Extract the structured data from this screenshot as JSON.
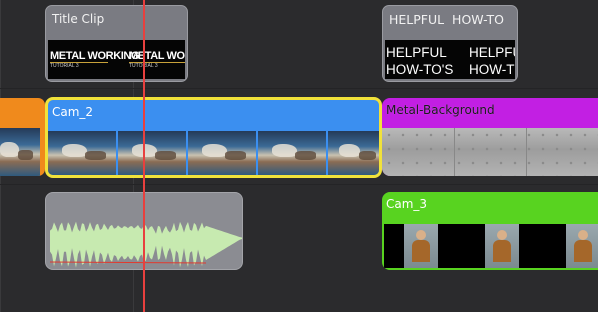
{
  "timeline": {
    "playhead_color": "#e8403e",
    "title_clips": [
      {
        "name": "Title Clip",
        "frames": [
          "METAL WORKING",
          "METAL WORKI"
        ],
        "subtitle": "TUTORIAL 3"
      },
      {
        "name": "HELPFUL  HOW-TO",
        "frames_line1": [
          "HELPFUL",
          "HELPFU"
        ],
        "frames_line2": [
          "HOW-TO'S",
          "HOW-T"
        ]
      }
    ],
    "video_clips": [
      {
        "name": "Cam_2",
        "color": "#3b8ff0",
        "selected": true,
        "selection_color": "#f1e23a"
      },
      {
        "name": "Metal-Background",
        "color": "#c21fe3"
      },
      {
        "name": "Cam_3",
        "color": "#58d320"
      }
    ],
    "audio_clip": {
      "waveform_color": "#c7eab0",
      "peak_color": "#e23a2e"
    }
  }
}
